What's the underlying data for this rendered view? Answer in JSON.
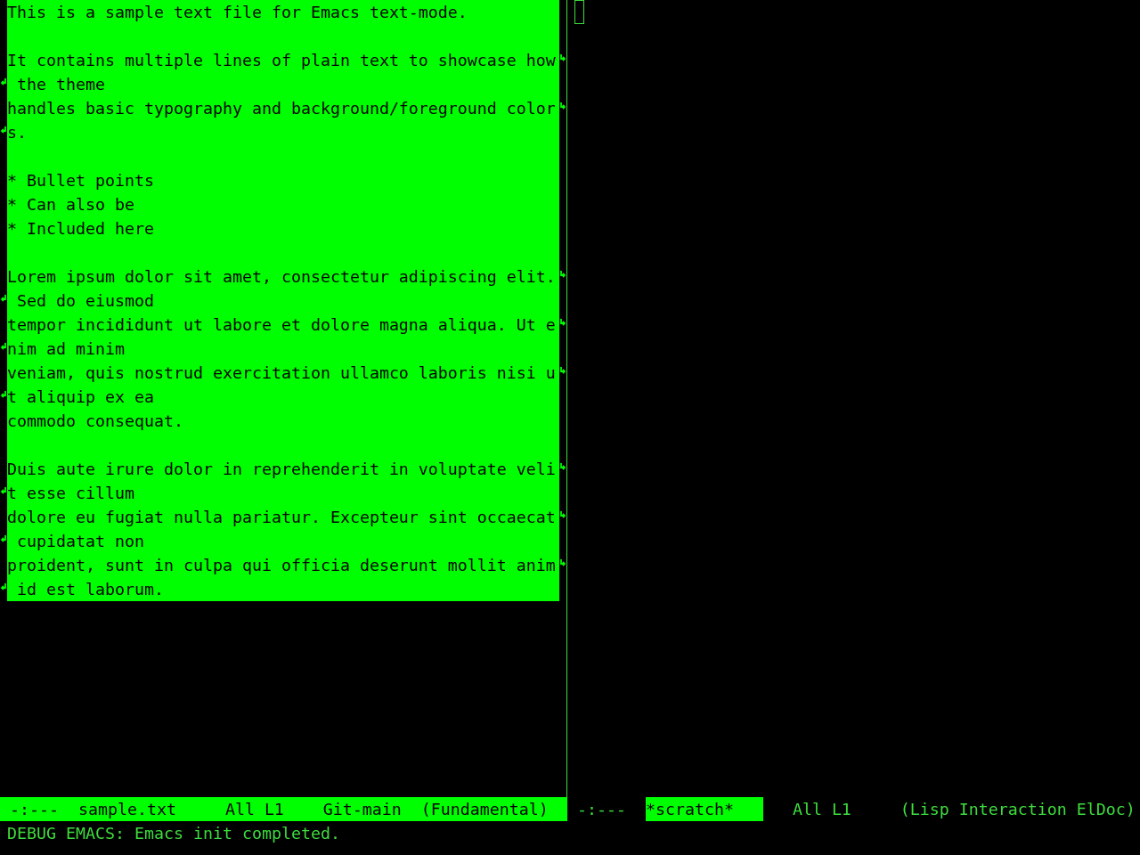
{
  "windows": [
    {
      "selected": true,
      "region_active": true,
      "paragraphs": [
        [
          {
            "text": "This is a sample text file for Emacs text-mode.",
            "wrapped": false
          }
        ],
        [
          {
            "text": "It contains multiple lines of plain text to showcase how",
            "wrapped": true
          },
          {
            "text": " the theme",
            "wrapped": false
          },
          {
            "text": "handles basic typography and background/foreground color",
            "wrapped": true
          },
          {
            "text": "s.",
            "wrapped": false
          }
        ],
        [
          {
            "text": "* Bullet points",
            "wrapped": false
          },
          {
            "text": "* Can also be",
            "wrapped": false
          },
          {
            "text": "* Included here",
            "wrapped": false
          }
        ],
        [
          {
            "text": "Lorem ipsum dolor sit amet, consectetur adipiscing elit.",
            "wrapped": true
          },
          {
            "text": " Sed do eiusmod",
            "wrapped": false
          },
          {
            "text": "tempor incididunt ut labore et dolore magna aliqua. Ut e",
            "wrapped": true
          },
          {
            "text": "nim ad minim",
            "wrapped": false
          },
          {
            "text": "veniam, quis nostrud exercitation ullamco laboris nisi u",
            "wrapped": true
          },
          {
            "text": "t aliquip ex ea",
            "wrapped": false
          },
          {
            "text": "commodo consequat.",
            "wrapped": false
          }
        ],
        [
          {
            "text": "Duis aute irure dolor in reprehenderit in voluptate veli",
            "wrapped": true
          },
          {
            "text": "t esse cillum",
            "wrapped": false
          },
          {
            "text": "dolore eu fugiat nulla pariatur. Excepteur sint occaecat",
            "wrapped": true
          },
          {
            "text": " cupidatat non",
            "wrapped": false
          },
          {
            "text": "proident, sunt in culpa qui officia deserunt mollit anim",
            "wrapped": true
          },
          {
            "text": " id est laborum.",
            "wrapped": false
          }
        ]
      ],
      "mode_line": {
        "status": "-:---",
        "buffer_name": {
          "text": "sample.txt",
          "highlighted": false
        },
        "position": "All L1",
        "vc_branch": "Git-main",
        "major_mode": "(Fundamental)"
      }
    },
    {
      "selected": false,
      "mode_line": {
        "status": "-:---",
        "buffer_name": {
          "text": "*scratch*",
          "highlighted": true
        },
        "position": "All L1",
        "major_mode": "(Lisp Interaction ElDoc)"
      }
    }
  ],
  "echo_area": "DEBUG EMACS: Emacs init completed."
}
